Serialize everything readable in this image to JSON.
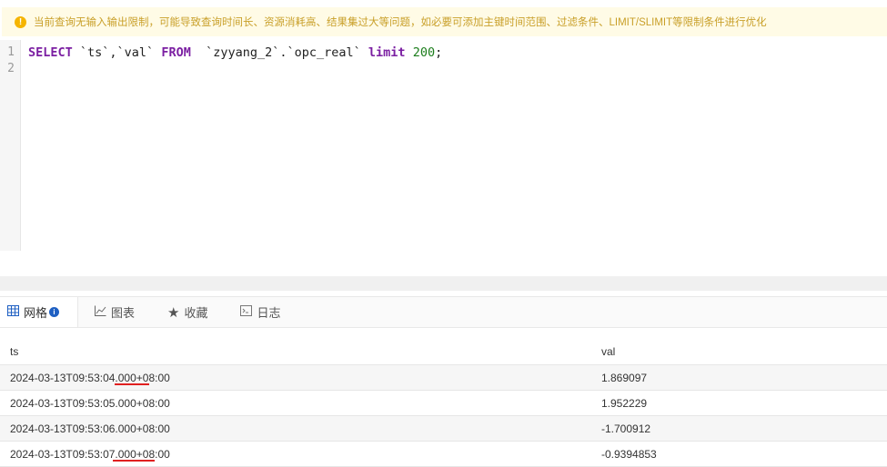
{
  "warning": {
    "icon": "warning-icon",
    "text": "当前查询无输入输出限制，可能导致查询时间长、资源消耗高、结果集过大等问题，如必要可添加主键时间范围、过滤条件、LIMIT/SLIMIT等限制条件进行优化"
  },
  "editor": {
    "line_numbers": [
      "1",
      "2"
    ],
    "sql": {
      "kw_select": "SELECT",
      "columns": " `ts`,`val` ",
      "kw_from": "FROM",
      "table": "  `zyyang_2`.`opc_real` ",
      "kw_limit": "limit",
      "space": " ",
      "limit_value": "200",
      "terminator": ";"
    }
  },
  "tabs": [
    {
      "label": "网格",
      "icon": "grid-icon",
      "active": true
    },
    {
      "label": "图表",
      "icon": "chart-icon",
      "active": false
    },
    {
      "label": "收藏",
      "icon": "star-icon",
      "active": false
    },
    {
      "label": "日志",
      "icon": "terminal-icon",
      "active": false
    }
  ],
  "table": {
    "columns": [
      "ts",
      "val"
    ],
    "rows": [
      {
        "ts": "2024-03-13T09:53:04.000+08:00",
        "val": "1.869097"
      },
      {
        "ts": "2024-03-13T09:53:05.000+08:00",
        "val": "1.952229"
      },
      {
        "ts": "2024-03-13T09:53:06.000+08:00",
        "val": "-1.700912"
      },
      {
        "ts": "2024-03-13T09:53:07.000+08:00",
        "val": "-0.9394853"
      }
    ]
  },
  "colors": {
    "warning_bg": "#fffbe6",
    "warning_text": "#c9a02a",
    "keyword": "#7b1fa2",
    "number": "#1b7d1b",
    "annotation_underline": "#e02020"
  }
}
